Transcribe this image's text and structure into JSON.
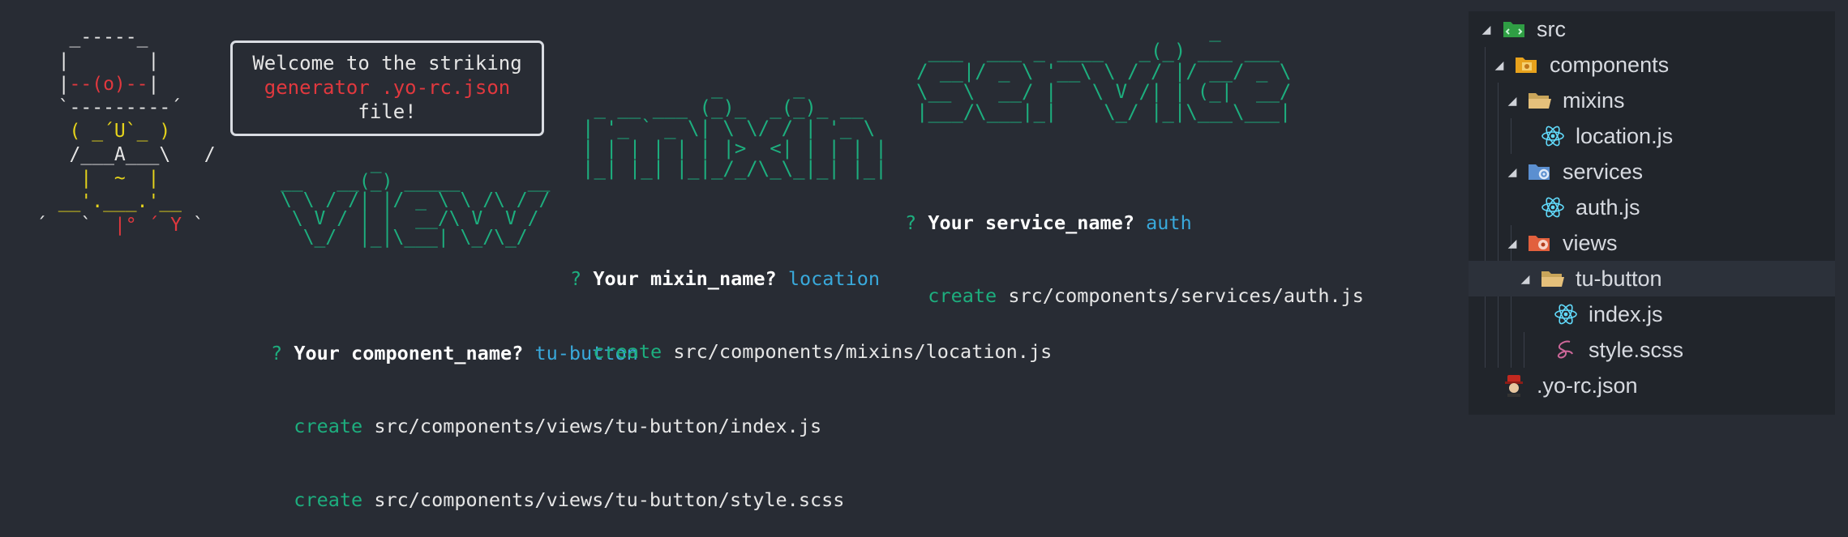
{
  "yeoman": {
    "hat_lines": [
      "   _-----_    ",
      "  |       |   ",
      "  |"
    ],
    "eye_line": "--(o)--",
    "brim": "  `---------´  ",
    "face": "   ( _´U`_ )   ",
    "arms": "   /___A___\\   /",
    "beard": "    |  ~  |     ",
    "chest": "  __'.___.'__   ",
    "feet_left": "´   `  ",
    "feet_mid": "|° ´ Y",
    "feet_right": " `"
  },
  "bubble": {
    "line1": "Welcome to the striking",
    "line2": "generator .yo-rc.json",
    "line3": "file!"
  },
  "ascii": {
    "view": "        _\n__   __(_) _____      __\n\\ \\ / /| |/ _ \\ \\ /\\ / /\n \\ V / | |  __/\\ V  V /\n  \\_/  |_|\\___| \\_/\\_/",
    "mixin": "           _      _\n _ __ ___ (_)_  _(_)_ __\n| '_ ` _ \\| \\ \\/ / | '_ \\\n| | | | | | |>  <| | | | |\n|_| |_| |_|_/_/\\_\\_|_| |_|",
    "service": "                         _\n ___  ___ _ ____   _(_) ___ ___\n/ __|/ _ \\ '__\\ \\ / / |/ __/ _ \\\n\\__ \\  __/ |   \\ V /| | (_|  __/\n|___/\\___|_|    \\_/ |_|\\___\\___|"
  },
  "prompts": {
    "component": {
      "q": "?",
      "label": "Your component_name?",
      "answer": "tu-button",
      "creates": [
        {
          "verb": "create",
          "path": "src/components/views/tu-button/index.js"
        },
        {
          "verb": "create",
          "path": "src/components/views/tu-button/style.scss"
        }
      ]
    },
    "mixin": {
      "q": "?",
      "label": "Your mixin_name?",
      "answer": "location",
      "creates": [
        {
          "verb": "create",
          "path": "src/components/mixins/location.js"
        }
      ]
    },
    "service": {
      "q": "?",
      "label": "Your service_name?",
      "answer": "auth",
      "creates": [
        {
          "verb": "create",
          "path": "src/components/services/auth.js"
        }
      ]
    }
  },
  "explorer": {
    "items": [
      {
        "label": "src",
        "icon": "src-folder-icon",
        "indent": 0,
        "tri": "◢"
      },
      {
        "label": "components",
        "icon": "components-folder-icon",
        "indent": 1,
        "tri": "◢"
      },
      {
        "label": "mixins",
        "icon": "folder-open-icon",
        "indent": 2,
        "tri": "◢"
      },
      {
        "label": "location.js",
        "icon": "react-icon",
        "indent": 3,
        "tri": ""
      },
      {
        "label": "services",
        "icon": "services-folder-icon",
        "indent": 2,
        "tri": "◢"
      },
      {
        "label": "auth.js",
        "icon": "react-icon",
        "indent": 3,
        "tri": ""
      },
      {
        "label": "views",
        "icon": "views-folder-icon",
        "indent": 2,
        "tri": "◢"
      },
      {
        "label": "tu-button",
        "icon": "folder-open-icon",
        "indent": 3,
        "tri": "◢"
      },
      {
        "label": "index.js",
        "icon": "react-icon",
        "indent": 4,
        "tri": ""
      },
      {
        "label": "style.scss",
        "icon": "sass-icon",
        "indent": 4,
        "tri": ""
      },
      {
        "label": ".yo-rc.json",
        "icon": "yeoman-icon",
        "indent": 0,
        "tri": ""
      }
    ]
  },
  "colors": {
    "background": "#282c34",
    "panel": "#21252b",
    "green": "#1dae7e",
    "blue": "#39a9db",
    "red": "#e0383e",
    "yellow": "#e5d31b"
  }
}
